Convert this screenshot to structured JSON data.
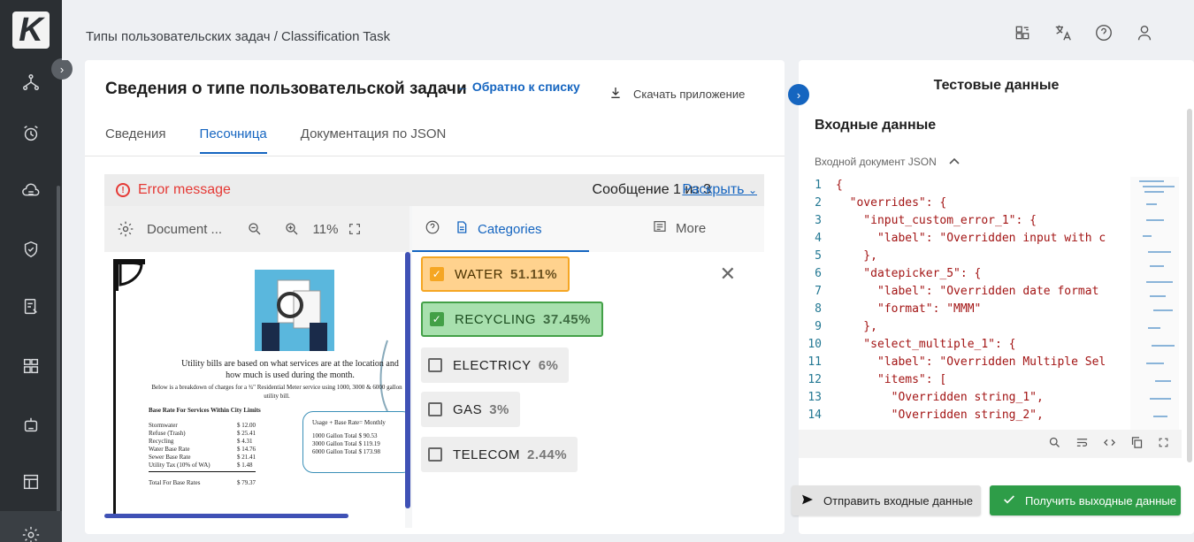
{
  "app": {
    "logo_letter": "K"
  },
  "breadcrumb": "Типы пользовательских задач  /  Classification Task",
  "main": {
    "title": "Сведения о типе пользовательской задачи",
    "back_link": "← Обратно к списку",
    "download": "Скачать приложение",
    "tabs": [
      "Сведения",
      "Песочница",
      "Документация по JSON"
    ],
    "active_tab": "Песочница"
  },
  "sandbox": {
    "error_message": "Error message",
    "message_counter": "Сообщение 1 из 3",
    "expand_link": "Раскрыть",
    "document_label": "Document ...",
    "zoom": "11%",
    "categories_tab": "Categories",
    "more_tab": "More",
    "categories": [
      {
        "name": "WATER",
        "percent": "51.11%",
        "checked": true,
        "color": "#f5a623"
      },
      {
        "name": "RECYCLING",
        "percent": "37.45%",
        "checked": true,
        "color": "#43a047"
      },
      {
        "name": "ELECTRICY",
        "percent": "6%",
        "checked": false
      },
      {
        "name": "GAS",
        "percent": "3%",
        "checked": false
      },
      {
        "name": "TELECOM",
        "percent": "2.44%",
        "checked": false
      }
    ],
    "document_preview": {
      "headline": "Utility bills are based on what services are at the location and how much is used during the month.",
      "breakdown": "Below is a breakdown of charges for a ¾\" Residential Meter service using 1000, 3000 & 6000 gallon utility bill.",
      "base_rate_title": "Base Rate For Services Within City Limits",
      "rates": [
        [
          "Stormwater",
          "$ 12.00"
        ],
        [
          "Refuse (Trash)",
          "$ 25.41"
        ],
        [
          "Recycling",
          "$ 4.31"
        ],
        [
          "Water Base Rate",
          "$ 14.76"
        ],
        [
          "Sewer Base Rate",
          "$ 21.41"
        ],
        [
          "Utility Tax (10% of WA)",
          "$ 1.48"
        ]
      ],
      "total_label": "Total For Base Rates",
      "total_value": "$ 79.37",
      "usage_title": "Usage + Base Rate= Monthly",
      "usage_rows": [
        "1000 Gallon Total   $ 90.53",
        "3000 Gallon Total   $ 119.19",
        "6000 Gallon Total   $ 173.98"
      ]
    }
  },
  "right_panel": {
    "title": "Тестовые данные",
    "heading": "Входные данные",
    "json_label": "Входной документ JSON",
    "code_lines": [
      "{",
      "  \"overrides\": {",
      "    \"input_custom_error_1\": {",
      "      \"label\": \"Overridden input with c",
      "    },",
      "    \"datepicker_5\": {",
      "      \"label\": \"Overridden date format",
      "      \"format\": \"MMM\"",
      "    },",
      "    \"select_multiple_1\": {",
      "      \"label\": \"Overridden Multiple Sel",
      "      \"items\": [",
      "        \"Overridden string_1\",",
      "        \"Overridden string_2\","
    ],
    "send_button": "Отправить входные данные",
    "get_button": "Получить выходные данные"
  },
  "colors": {
    "rail": "#2b2f33",
    "accent": "#1565c0",
    "error": "#e53935",
    "success": "#2e9d48"
  }
}
